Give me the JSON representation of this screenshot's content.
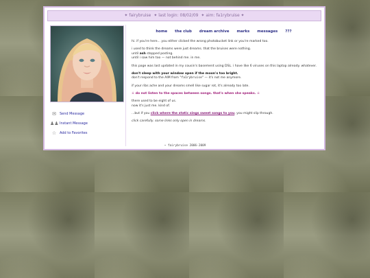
{
  "header": {
    "bar": [
      "✦ fairybruise",
      "✦ last login: 08/02/09",
      "✦ aim: fa1rybruise ✦"
    ]
  },
  "profile": {
    "actions": [
      {
        "label": "Send Message",
        "icon": "mail-icon"
      },
      {
        "label": "Instant Message",
        "icon": "users-icon"
      },
      {
        "label": "Add to Favorites",
        "icon": "favorites-icon"
      }
    ]
  },
  "nav": [
    "home",
    "the club",
    "dream archive",
    "marks",
    "messages",
    "???"
  ],
  "content": {
    "p1": "hi. if you're here... you either clicked the wrong photobucket link or you're marked too.",
    "p2_l1": "i used to think the dreams were just dreams. that the bruises were nothing.",
    "p2_l2_a": "until ",
    "p2_l2_b": "ash",
    "p2_l2_c": " stopped posting.",
    "p2_l3": "until i saw him too — not behind me. in me.",
    "p3": "this page was last updated in my cousin's basement using DSL. i have like 6 viruses on this laptop already. whatever.",
    "p4_bold": "don't sleep with your window open if the moon's too bright.",
    "p4_a": "don't respond to the AIM from \"",
    "p4_mono": "fa1rybruise",
    "p4_b": "\" — it's not me anymore.",
    "p5": "if your ribs ache and your dreams smell like sugar rot, it's already too late.",
    "warning": "☠ do not listen to the spaces between songs. that's when she speaks. ☠",
    "p7_l1": "there used to be eight of us.",
    "p7_l2": "now it's just me. kind of.",
    "p8_a": "...but if you ",
    "p8_link": "click where the static sings sweet songs to you",
    "p8_b": ", you might slip through.",
    "p9": "click carefully. some links only open in dreams."
  },
  "footer": "~ fairybruise 2006-2009"
}
